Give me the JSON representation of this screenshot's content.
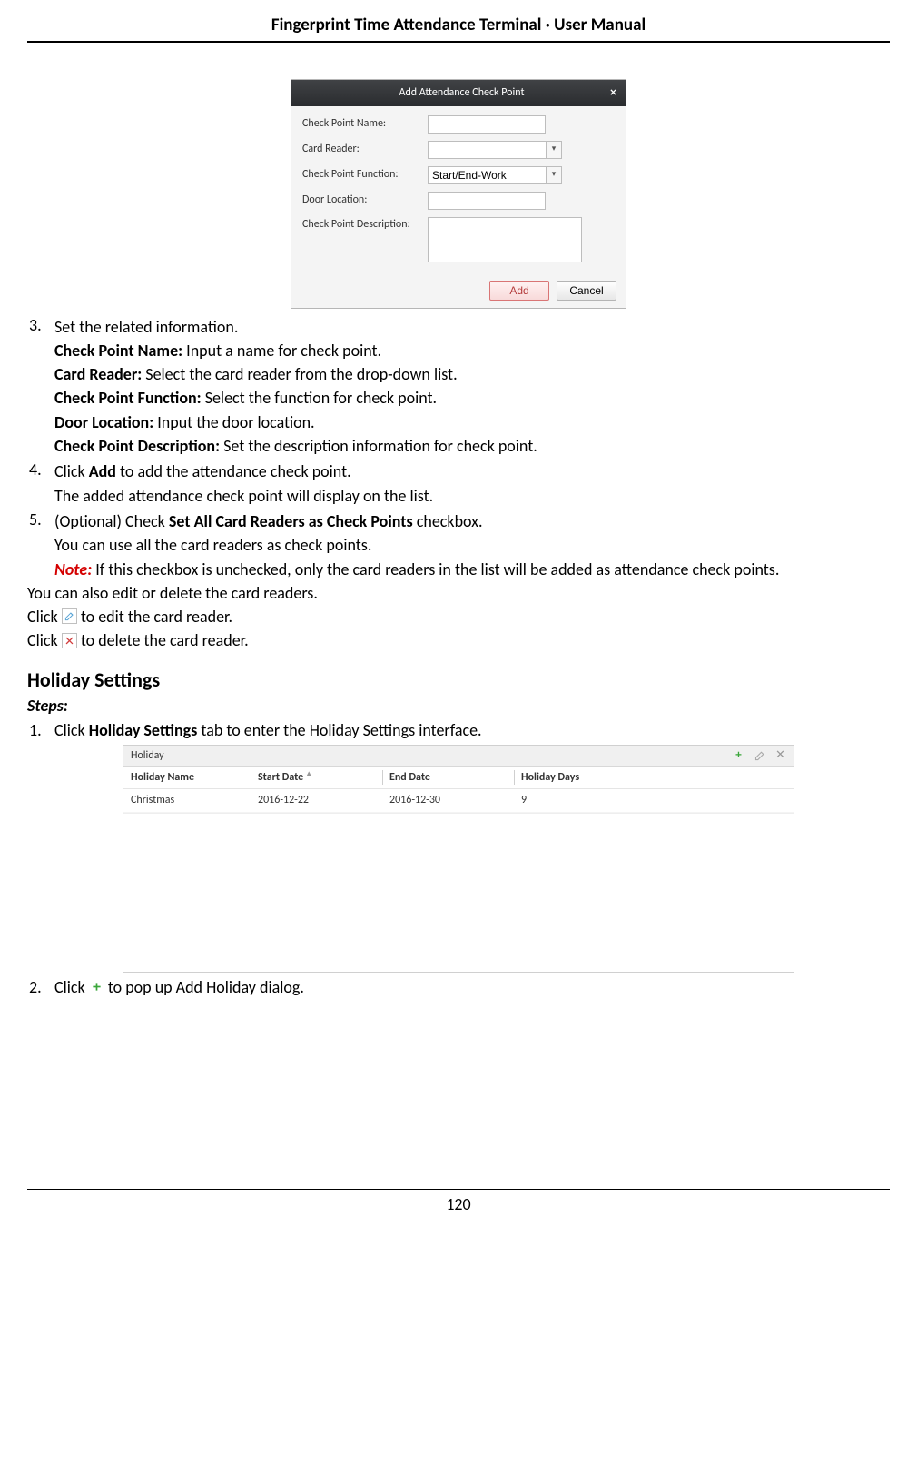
{
  "header": {
    "doc_title": "Fingerprint Time Attendance Terminal · User Manual"
  },
  "page_number": "120",
  "dialog": {
    "title": "Add Attendance Check Point",
    "close_symbol": "×",
    "fields": {
      "check_point_name": {
        "label": "Check Point Name:",
        "value": ""
      },
      "card_reader": {
        "label": "Card Reader:",
        "value": ""
      },
      "check_point_function": {
        "label": "Check Point Function:",
        "value": "Start/End-Work"
      },
      "door_location": {
        "label": "Door Location:",
        "value": ""
      },
      "check_point_description": {
        "label": "Check Point Description:",
        "value": ""
      }
    },
    "buttons": {
      "add": "Add",
      "cancel": "Cancel"
    }
  },
  "step3": {
    "num": "3.",
    "line0": "Set the related information.",
    "cpn_label": "Check Point Name:",
    "cpn_text": " Input a name for check point.",
    "cr_label": "Card Reader:",
    "cr_text": " Select the card reader from the drop-down list.",
    "cpf_label": "Check Point Function:",
    "cpf_text": " Select the function for check point.",
    "dl_label": "Door Location:",
    "dl_text": " Input the door location.",
    "cpd_label": "Check Point Description:",
    "cpd_text": " Set the description information for check point."
  },
  "step4": {
    "num": "4.",
    "line0a": "Click ",
    "line0b": "Add",
    "line0c": " to add the attendance check point.",
    "line1": "The added attendance check point will display on the list."
  },
  "step5": {
    "num": "5.",
    "line0a": "(Optional) Check ",
    "line0b": "Set All Card Readers as Check Points",
    "line0c": " checkbox.",
    "line1": "You can use all the card readers as check points.",
    "note_label": "Note:",
    "note_body": " If this checkbox is unchecked, only the card readers in the list will be added as attendance check points."
  },
  "after_steps": {
    "line_edit_delete": "You can also edit or delete the card readers.",
    "click_edit_a": "Click ",
    "click_edit_b": " to edit the card reader.",
    "click_delete_a": "Click ",
    "click_delete_b": " to delete the card reader."
  },
  "holiday_section": {
    "heading": "Holiday Settings",
    "steps_label": "Steps:",
    "step1_num": "1.",
    "step1_a": "Click ",
    "step1_b": "Holiday Settings",
    "step1_c": " tab to enter the Holiday Settings interface.",
    "panel": {
      "title": "Holiday",
      "plus": "+",
      "edit": "✎",
      "close": "✕",
      "headers": {
        "name": "Holiday Name",
        "start": "Start Date",
        "end": "End Date",
        "days": "Holiday Days"
      },
      "rows": [
        {
          "name": "Christmas",
          "start": "2016-12-22",
          "end": "2016-12-30",
          "days": "9"
        }
      ]
    },
    "step2_num": "2.",
    "step2_a": "Click ",
    "step2_b": " to pop up Add Holiday dialog."
  }
}
